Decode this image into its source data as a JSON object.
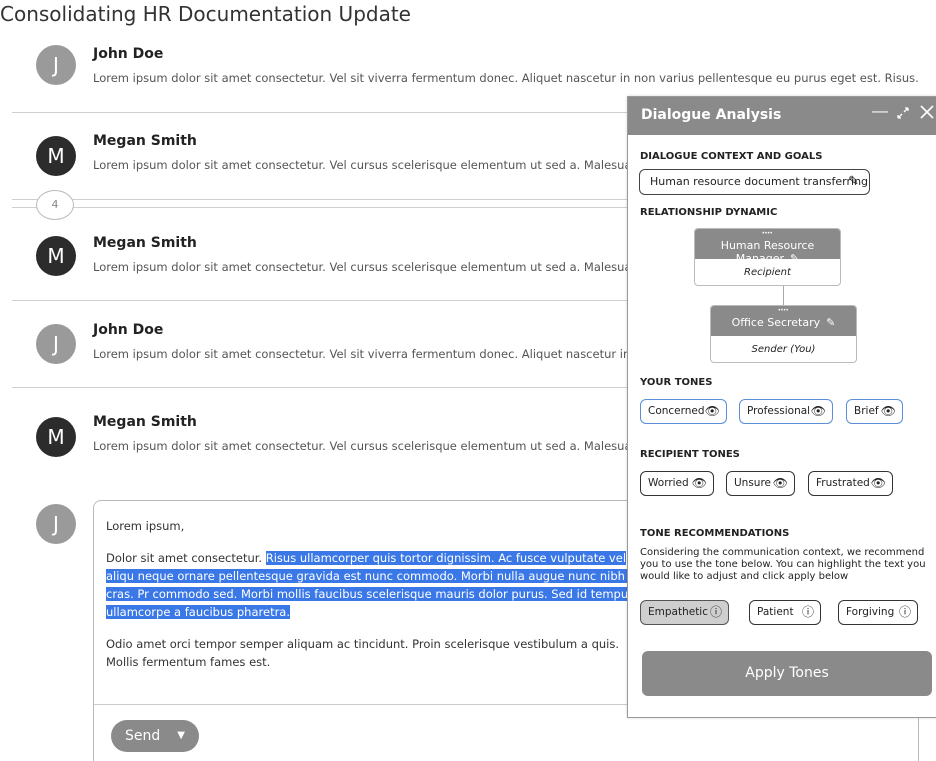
{
  "page": {
    "title": "Consolidating HR Documentation Update"
  },
  "thread": {
    "messages": [
      {
        "initial": "J",
        "name": "John Doe",
        "body": "Lorem ipsum dolor sit amet consectetur. Vel sit viverra fermentum donec. Aliquet nascetur in non varius pellentesque eu purus eget est. Risus."
      },
      {
        "initial": "M",
        "name": "Megan Smith",
        "body": "Lorem ipsum dolor sit amet consectetur. Vel cursus scelerisque elementum ut sed a. Malesuada u"
      },
      {
        "initial": "M",
        "name": "Megan Smith",
        "body": "Lorem ipsum dolor sit amet consectetur. Vel cursus scelerisque elementum ut sed a. Malesuada u"
      },
      {
        "initial": "J",
        "name": "John Doe",
        "body": "Lorem ipsum dolor sit amet consectetur. Vel sit viverra fermentum donec. Aliquet nascetur in non"
      },
      {
        "initial": "M",
        "name": "Megan Smith",
        "body": "Lorem ipsum dolor sit amet consectetur. Vel cursus scelerisque elementum ut sed a. Malesuada u"
      }
    ],
    "collapsed_count": "4"
  },
  "composer": {
    "avatar_initial": "J",
    "greeting": "Lorem ipsum,",
    "para1_plain": "Dolor sit amet consectetur. ",
    "para1_highlight": "Risus ullamcorper quis tortor dignissim. Ac fusce vulputate vel aliqu neque ornare pellentesque gravida est nunc commodo. Morbi nulla augue nunc nibh in cras. Pr commodo sed. Morbi mollis faucibus scelerisque mauris dolor purus. Sed id tempus ullamcorpe a faucibus pharetra.",
    "para2": "Odio amet orci tempor semper aliquam ac tincidunt. Proin scelerisque vestibulum a quis. Mollis fermentum fames est.",
    "send_label": "Send",
    "send_caret": "▼"
  },
  "panel": {
    "title": "Dialogue Analysis",
    "icons": {
      "minimize": "minimize-icon",
      "expand": "expand-icon",
      "close": "close-icon"
    },
    "context": {
      "label": "DIALOGUE CONTEXT AND GOALS",
      "value": "Human resource document transferring"
    },
    "relationship": {
      "label": "RELATIONSHIP DYNAMIC",
      "roles": [
        {
          "dots": "••••",
          "name": "Human Resource Manager",
          "role": "Recipient"
        },
        {
          "dots": "••••",
          "name": "Office Secretary",
          "role": "Sender (You)"
        }
      ]
    },
    "your_tones": {
      "label": "YOUR TONES",
      "items": [
        "Concerned",
        "Professional",
        "Brief"
      ]
    },
    "recipient_tones": {
      "label": "RECIPIENT TONES",
      "items": [
        "Worried",
        "Unsure",
        "Frustrated"
      ]
    },
    "recommendations": {
      "label": "TONE RECOMMENDATIONS",
      "text": "Considering the communication context, we recommend you to use the tone below. You can highlight the text you would like to adjust and click apply below",
      "items": [
        "Empathetic",
        "Patient",
        "Forgiving"
      ],
      "selected": "Empathetic"
    },
    "apply_label": "Apply Tones"
  },
  "colors": {
    "accent_grey": "#8a8a8a",
    "highlight": "#3b78e7",
    "tone_border": "#5b8fd9"
  }
}
